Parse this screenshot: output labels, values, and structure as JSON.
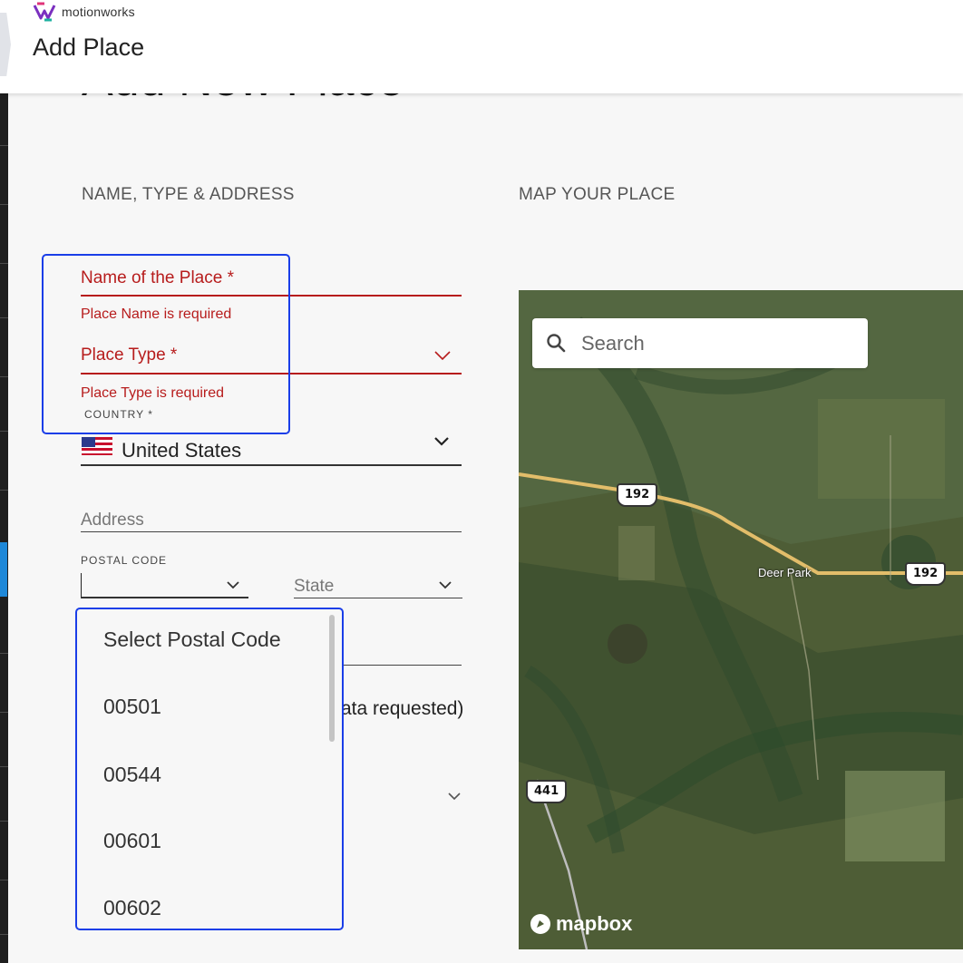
{
  "header": {
    "brand": "motionworks",
    "page_title": "Add Place"
  },
  "main": {
    "heading": "Add New Place",
    "left_section_label": "NAME, TYPE & ADDRESS",
    "right_section_label": "MAP YOUR PLACE"
  },
  "form": {
    "name_label": "Name of the Place *",
    "name_error": "Place Name is required",
    "type_label": "Place Type *",
    "type_error": "Place Type is required",
    "country_label": "COUNTRY *",
    "country_value": "United States",
    "address_label": "Address",
    "postal_label": "POSTAL CODE",
    "state_label": "State",
    "partial_hint": "ata requested)"
  },
  "postal_dropdown": {
    "options": [
      "Select Postal Code",
      "00501",
      "00544",
      "00601",
      "00602"
    ]
  },
  "map": {
    "search_placeholder": "Search",
    "road_shield_1": "192",
    "road_shield_2": "192",
    "road_shield_3": "441",
    "place_label": "Deer Park",
    "attribution": "mapbox"
  },
  "colors": {
    "error_red": "#b71c1c",
    "highlight_blue": "#1a3ee8",
    "rail_active": "#1e88d8"
  }
}
